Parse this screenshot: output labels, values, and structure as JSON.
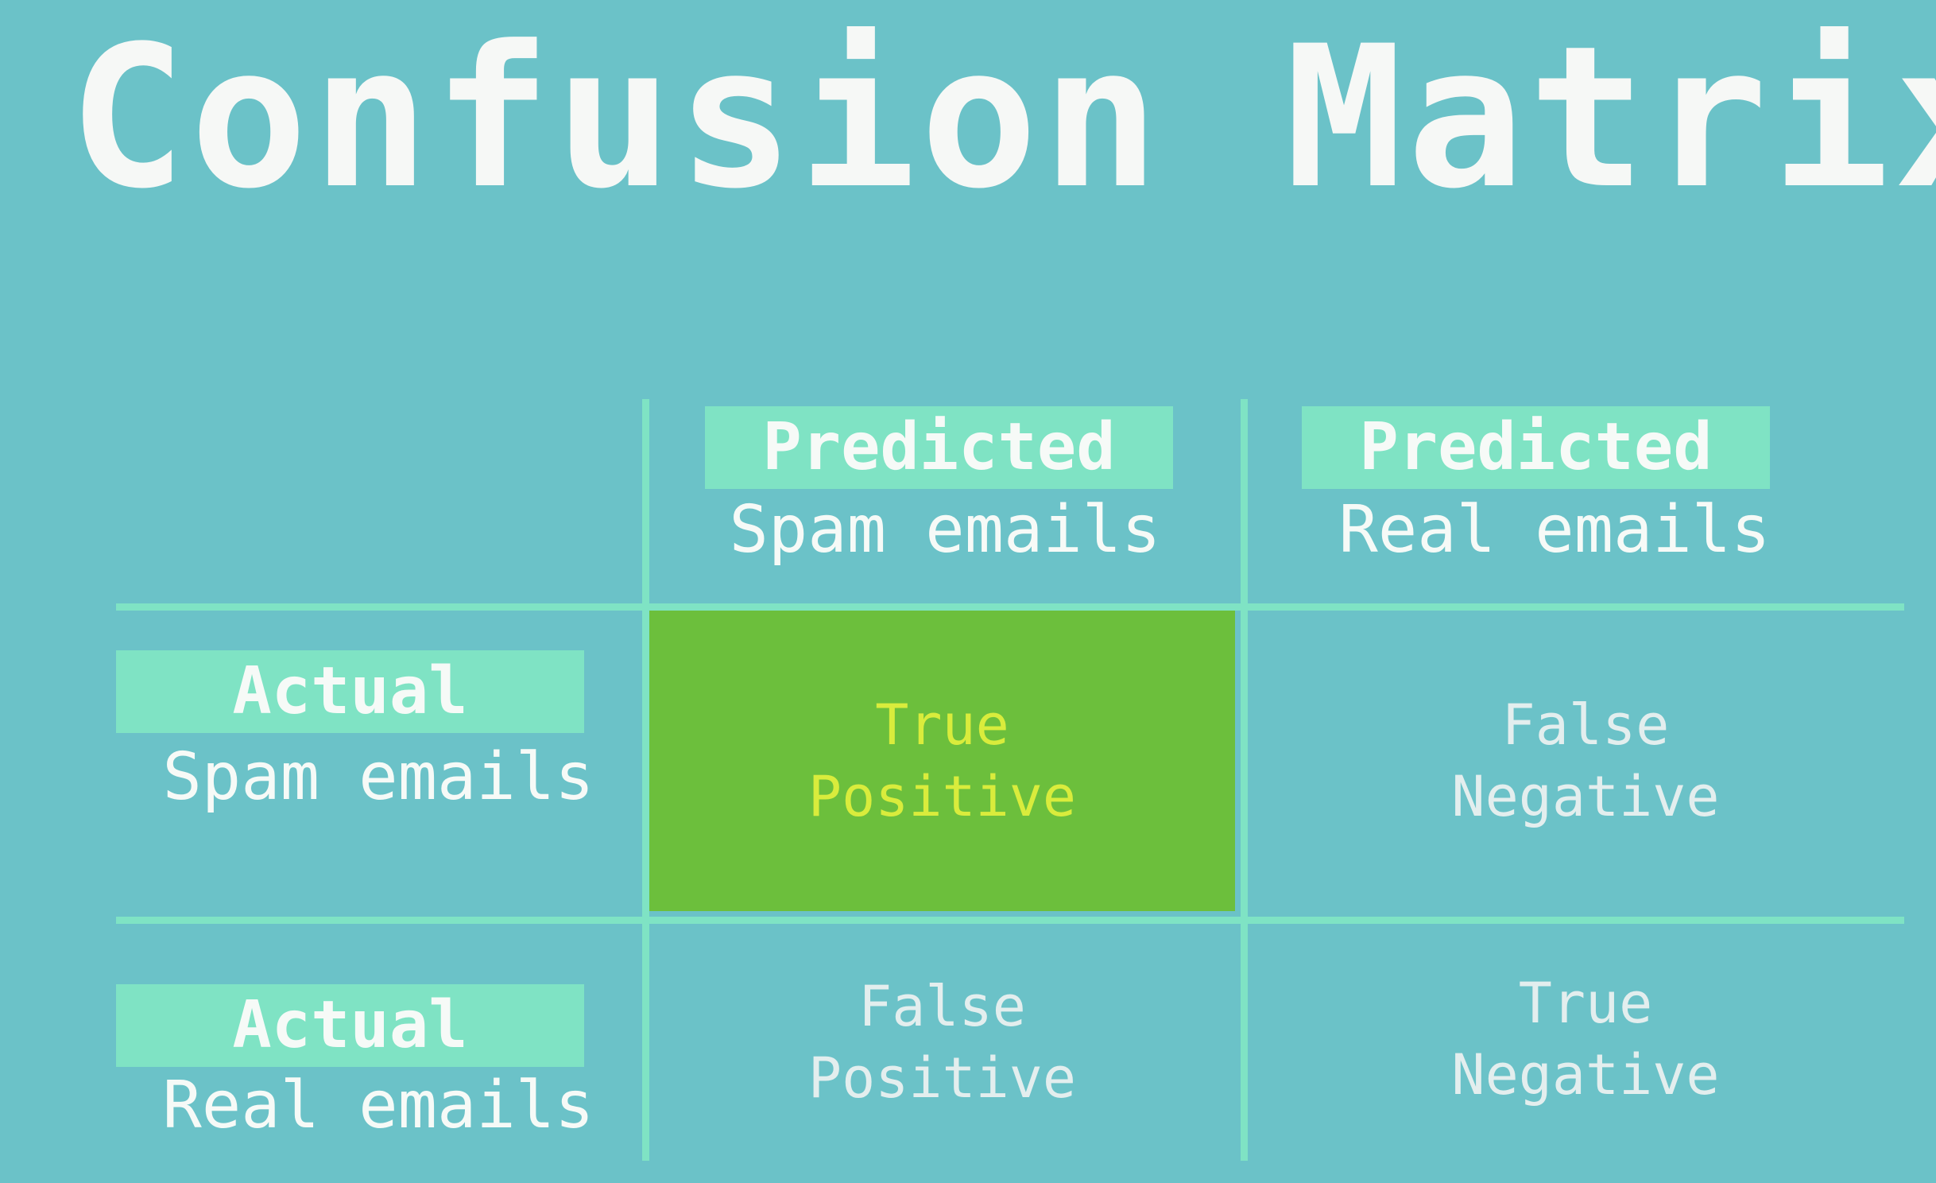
{
  "title": "Confusion Matrix",
  "colors": {
    "background": "#6bc2c8",
    "grid_and_tags": "#7fe3c4",
    "highlight_cell": "#6cbf3c",
    "highlight_text": "#d9ec3c"
  },
  "columns": [
    {
      "tag": "Predicted",
      "label": "Spam emails"
    },
    {
      "tag": "Predicted",
      "label": "Real emails"
    }
  ],
  "rows": [
    {
      "tag": "Actual",
      "label": "Spam emails"
    },
    {
      "tag": "Actual",
      "label": "Real emails"
    }
  ],
  "cells": {
    "true_positive": {
      "line1": "True",
      "line2": "Positive",
      "highlighted": true
    },
    "false_negative": {
      "line1": "False",
      "line2": "Negative"
    },
    "false_positive": {
      "line1": "False",
      "line2": "Positive"
    },
    "true_negative": {
      "line1": "True",
      "line2": "Negative"
    }
  }
}
